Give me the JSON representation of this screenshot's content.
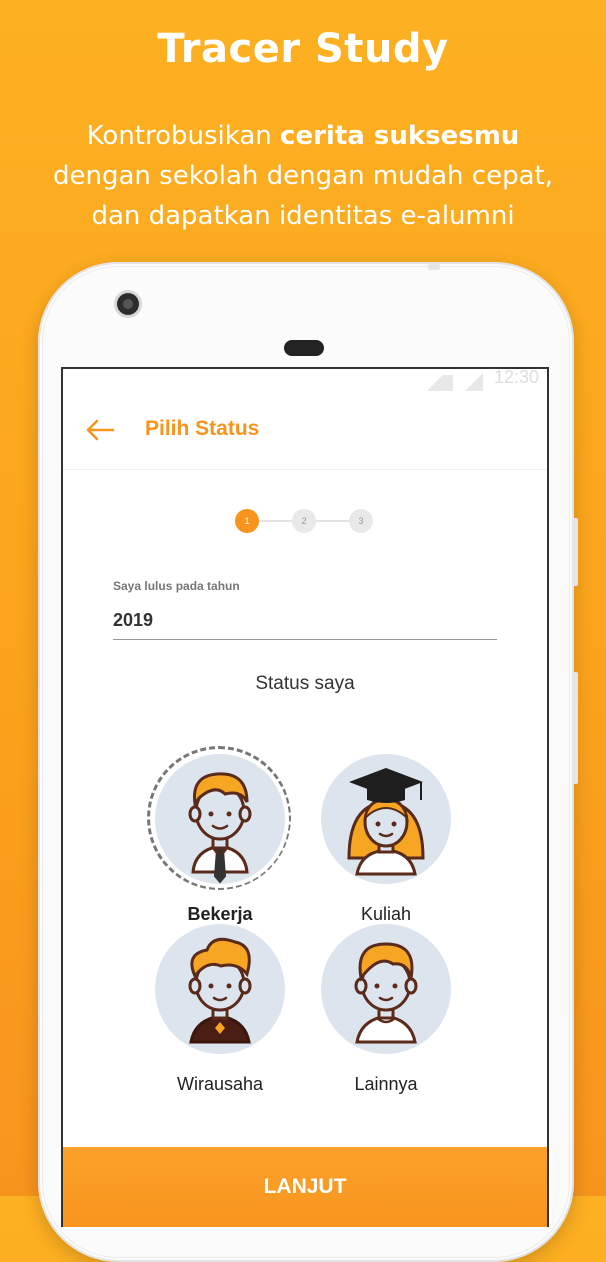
{
  "promo": {
    "title": "Tracer Study",
    "line1_prefix": "Kontrobusikan ",
    "line1_bold": "cerita suksesmu",
    "line2": "dengan sekolah dengan mudah cepat,",
    "line3": "dan dapatkan identitas e-alumni"
  },
  "statusbar": {
    "time": "12:30"
  },
  "appbar": {
    "title": "Pilih Status"
  },
  "stepper": {
    "steps": [
      "1",
      "2",
      "3"
    ],
    "active": 1
  },
  "form": {
    "graduation_label": "Saya lulus pada tahun",
    "graduation_value": "2019"
  },
  "status": {
    "title": "Status saya",
    "options": [
      {
        "label": "Bekerja",
        "selected": true
      },
      {
        "label": "Kuliah",
        "selected": false
      },
      {
        "label": "Wirausaha",
        "selected": false
      },
      {
        "label": "Lainnya",
        "selected": false
      }
    ]
  },
  "cta": {
    "label": "LANJUT"
  },
  "colors": {
    "accent": "#F7941D",
    "background": "#FDB022",
    "avatar_bg": "#DCE4EE",
    "hair": "#F6A623"
  }
}
